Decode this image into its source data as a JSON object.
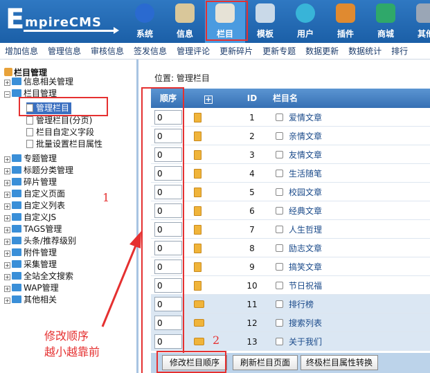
{
  "header": {
    "logo_initial": "E",
    "logo_rest": "mpireCMS",
    "nav": [
      {
        "label": "系统",
        "icon": "globe-icon",
        "color": "#2a6ad0"
      },
      {
        "label": "信息",
        "icon": "notepad-icon",
        "color": "#d9c79a"
      },
      {
        "label": "栏目",
        "icon": "folder-icon",
        "color": "#e6e2d6"
      },
      {
        "label": "模板",
        "icon": "window-icon",
        "color": "#c9d9e8"
      },
      {
        "label": "用户",
        "icon": "user-icon",
        "color": "#38b4d8"
      },
      {
        "label": "插件",
        "icon": "tools-icon",
        "color": "#e08a30"
      },
      {
        "label": "商城",
        "icon": "money-icon",
        "color": "#2fa86a"
      },
      {
        "label": "其他",
        "icon": "gear-icon",
        "color": "#9aa6b6"
      }
    ]
  },
  "submenu": [
    "增加信息",
    "管理信息",
    "审核信息",
    "签发信息",
    "管理评论",
    "更新碎片",
    "更新专题",
    "数据更新",
    "数据统计",
    "排行"
  ],
  "tree": {
    "root": "栏目管理",
    "nodes": [
      {
        "label": "信息相关管理",
        "sign": "+"
      },
      {
        "label": "栏目管理",
        "sign": "−"
      },
      {
        "label": "专题管理",
        "sign": "+"
      },
      {
        "label": "标题分类管理",
        "sign": "+"
      },
      {
        "label": "碎片管理",
        "sign": "+"
      },
      {
        "label": "自定义页面",
        "sign": "+"
      },
      {
        "label": "自定义列表",
        "sign": "+"
      },
      {
        "label": "自定义JS",
        "sign": "+"
      },
      {
        "label": "TAGS管理",
        "sign": "+"
      },
      {
        "label": "头条/推荐级别",
        "sign": "+"
      },
      {
        "label": "附件管理",
        "sign": "+"
      },
      {
        "label": "采集管理",
        "sign": "+"
      },
      {
        "label": "全站全文搜索",
        "sign": "+"
      },
      {
        "label": "WAP管理",
        "sign": "+"
      },
      {
        "label": "其他相关",
        "sign": "+"
      }
    ],
    "children": [
      "管理栏目",
      "管理栏目(分页)",
      "栏目自定义字段",
      "批量设置栏目属性"
    ]
  },
  "location": {
    "prefix": "位置:",
    "link": "管理栏目"
  },
  "table": {
    "headers": {
      "order": "顺序",
      "plus": "+",
      "id": "ID",
      "name": "栏目名"
    },
    "rows": [
      {
        "order": "0",
        "id": "1",
        "name": "爱情文章",
        "type": "doc"
      },
      {
        "order": "0",
        "id": "2",
        "name": "亲情文章",
        "type": "doc"
      },
      {
        "order": "0",
        "id": "3",
        "name": "友情文章",
        "type": "doc"
      },
      {
        "order": "0",
        "id": "4",
        "name": "生活随笔",
        "type": "doc"
      },
      {
        "order": "0",
        "id": "5",
        "name": "校园文章",
        "type": "doc"
      },
      {
        "order": "0",
        "id": "6",
        "name": "经典文章",
        "type": "doc"
      },
      {
        "order": "0",
        "id": "7",
        "name": "人生哲理",
        "type": "doc"
      },
      {
        "order": "0",
        "id": "8",
        "name": "励志文章",
        "type": "doc"
      },
      {
        "order": "0",
        "id": "9",
        "name": "搞笑文章",
        "type": "doc"
      },
      {
        "order": "0",
        "id": "10",
        "name": "节日祝福",
        "type": "doc"
      },
      {
        "order": "0",
        "id": "11",
        "name": "排行榜",
        "type": "folder"
      },
      {
        "order": "0",
        "id": "12",
        "name": "搜索列表",
        "type": "folder"
      },
      {
        "order": "0",
        "id": "13",
        "name": "关于我们",
        "type": "folder"
      }
    ]
  },
  "buttons": [
    "修改栏目顺序",
    "刷新栏目页面",
    "终极栏目属性转换"
  ],
  "annotations": {
    "n1": "1",
    "n2": "2",
    "note_line1": "修改顺序",
    "note_line2": "越小越靠前"
  },
  "colors": {
    "header_blue": "#1b5fa7",
    "annotation_red": "#e53030",
    "row_alt": "#dbe7f3"
  }
}
